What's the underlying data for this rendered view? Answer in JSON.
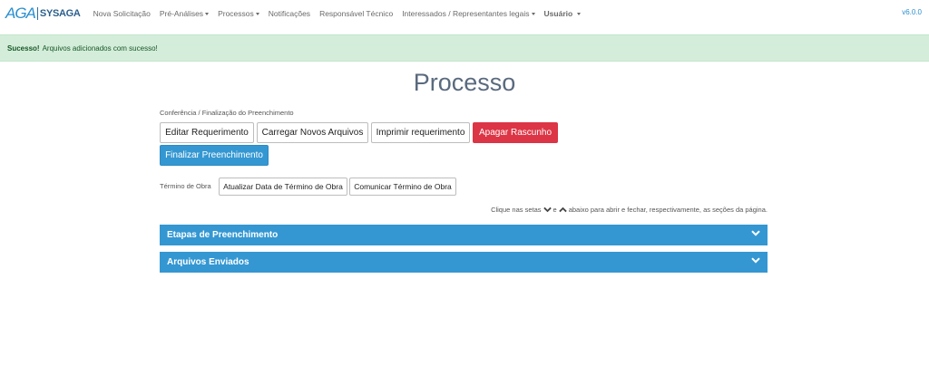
{
  "brand": {
    "logo_text": "AGA",
    "name": "SYSAGA"
  },
  "nav": {
    "items": [
      {
        "label": "Nova Solicitação",
        "dropdown": false,
        "bold": false
      },
      {
        "label": "Pré-Análises",
        "dropdown": true,
        "bold": false
      },
      {
        "label": "Processos",
        "dropdown": true,
        "bold": false
      },
      {
        "label": "Notificações",
        "dropdown": false,
        "bold": false
      },
      {
        "label": "Responsável Técnico",
        "dropdown": false,
        "bold": false
      },
      {
        "label": "Interessados / Representantes legais",
        "dropdown": true,
        "bold": false
      },
      {
        "label": "Usuário",
        "dropdown": true,
        "bold": true
      }
    ],
    "version": "v6.0.0"
  },
  "alert": {
    "title": "Sucesso!",
    "message": "Arquivos adicionados com sucesso!"
  },
  "page": {
    "title": "Processo",
    "breadcrumb": "Conferência / Finalização do Preenchimento"
  },
  "actions": {
    "edit": "Editar Requerimento",
    "upload": "Carregar Novos Arquivos",
    "print": "Imprimir requerimento",
    "delete": "Apagar Rascunho",
    "finalize": "Finalizar Preenchimento"
  },
  "obra": {
    "label": "Término de Obra",
    "update": "Atualizar Data de Término de Obra",
    "communicate": "Comunicar Término de Obra"
  },
  "hint": {
    "part1": "Clique nas setas",
    "part2": "e",
    "part3": "abaixo para abrir e fechar, respectivamente, as seções da página."
  },
  "sections": [
    {
      "title": "Etapas de Preenchimento"
    },
    {
      "title": "Arquivos Enviados"
    }
  ],
  "colors": {
    "primary": "#3497d2",
    "danger": "#dc3545",
    "success_bg": "#d4edda",
    "success_text": "#155724"
  }
}
